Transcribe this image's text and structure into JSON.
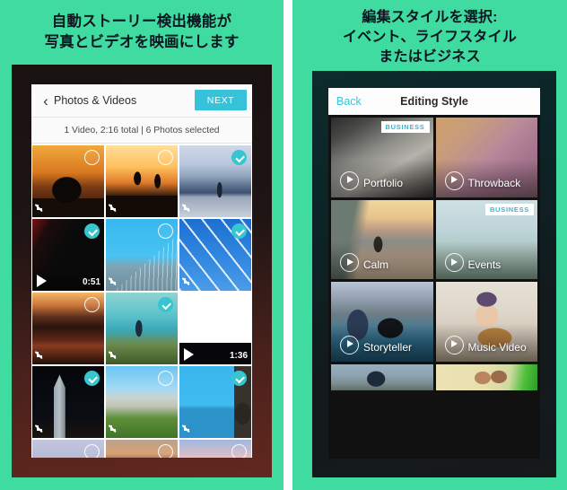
{
  "left_panel": {
    "background_color": "#3fdba0",
    "caption_lines": [
      "自動ストーリー検出機能が",
      "写真とビデオを映画にします"
    ],
    "app": {
      "navbar": {
        "back_label": "Photos & Videos",
        "back_icon": "chevron-left-icon",
        "next_label": "NEXT",
        "next_color": "#36c2d8"
      },
      "status_text": "1 Video, 2:16 total | 6 Photos selected",
      "thumbnails": [
        {
          "id": "t1",
          "kind": "photo",
          "selected": false,
          "scene": "sunset-silhouette-person"
        },
        {
          "id": "t2",
          "kind": "photo",
          "selected": false,
          "scene": "skateboarder-sunset"
        },
        {
          "id": "t3",
          "kind": "photo",
          "selected": true,
          "scene": "rooftop-walker-city"
        },
        {
          "id": "t4",
          "kind": "video",
          "selected": true,
          "duration": "0:51",
          "scene": "beach-lens-circle"
        },
        {
          "id": "t5",
          "kind": "photo",
          "selected": false,
          "scene": "golden-gate-bridge"
        },
        {
          "id": "t6",
          "kind": "photo",
          "selected": true,
          "scene": "jet-formation-smoke"
        },
        {
          "id": "t7",
          "kind": "photo",
          "selected": false,
          "scene": "red-clouds-sunset"
        },
        {
          "id": "t8",
          "kind": "photo",
          "selected": true,
          "scene": "hiker-over-turquoise-sea"
        },
        {
          "id": "t9",
          "kind": "video",
          "selected": false,
          "duration": "1:36",
          "scene": "orange-sun-horizon"
        },
        {
          "id": "t10",
          "kind": "photo",
          "selected": true,
          "scene": "night-tower-monument"
        },
        {
          "id": "t11",
          "kind": "photo",
          "selected": false,
          "scene": "city-park-skyline"
        },
        {
          "id": "t12",
          "kind": "photo",
          "selected": true,
          "scene": "blue-sky-dome-building"
        },
        {
          "id": "t13",
          "kind": "photo",
          "selected": false,
          "scene": "pale-horizon-strip"
        },
        {
          "id": "t14",
          "kind": "photo",
          "selected": false,
          "scene": "dusk-lamp-post"
        },
        {
          "id": "t15",
          "kind": "photo",
          "selected": false,
          "scene": "pink-cloud-sky"
        }
      ]
    }
  },
  "right_panel": {
    "background_color": "#3fdba0",
    "caption_lines": [
      "編集スタイルを選択:",
      "イベント、ライフスタイル",
      "またはビジネス"
    ],
    "app": {
      "navbar": {
        "back_label": "Back",
        "title": "Editing Style",
        "back_color": "#35c6e0"
      },
      "badge_label": "BUSINESS",
      "styles": [
        {
          "id": "s1",
          "label": "Portfolio",
          "badge": "BUSINESS",
          "scene": "flatlay-desk-camera"
        },
        {
          "id": "s2",
          "label": "Throwback",
          "badge": null,
          "scene": "retro-camera-wood"
        },
        {
          "id": "s3",
          "label": "Calm",
          "badge": null,
          "scene": "surfer-beach-sunset"
        },
        {
          "id": "s4",
          "label": "Events",
          "badge": "BUSINESS",
          "scene": "white-balloons-field"
        },
        {
          "id": "s5",
          "label": "Storyteller",
          "badge": null,
          "scene": "videographer-canyon"
        },
        {
          "id": "s6",
          "label": "Music Video",
          "badge": null,
          "scene": "girl-guitar-beanie"
        },
        {
          "id": "s7",
          "label": "",
          "badge": null,
          "scene": "skater-palm-trees"
        },
        {
          "id": "s8",
          "label": "",
          "badge": null,
          "scene": "couple-celebrating"
        }
      ]
    }
  }
}
